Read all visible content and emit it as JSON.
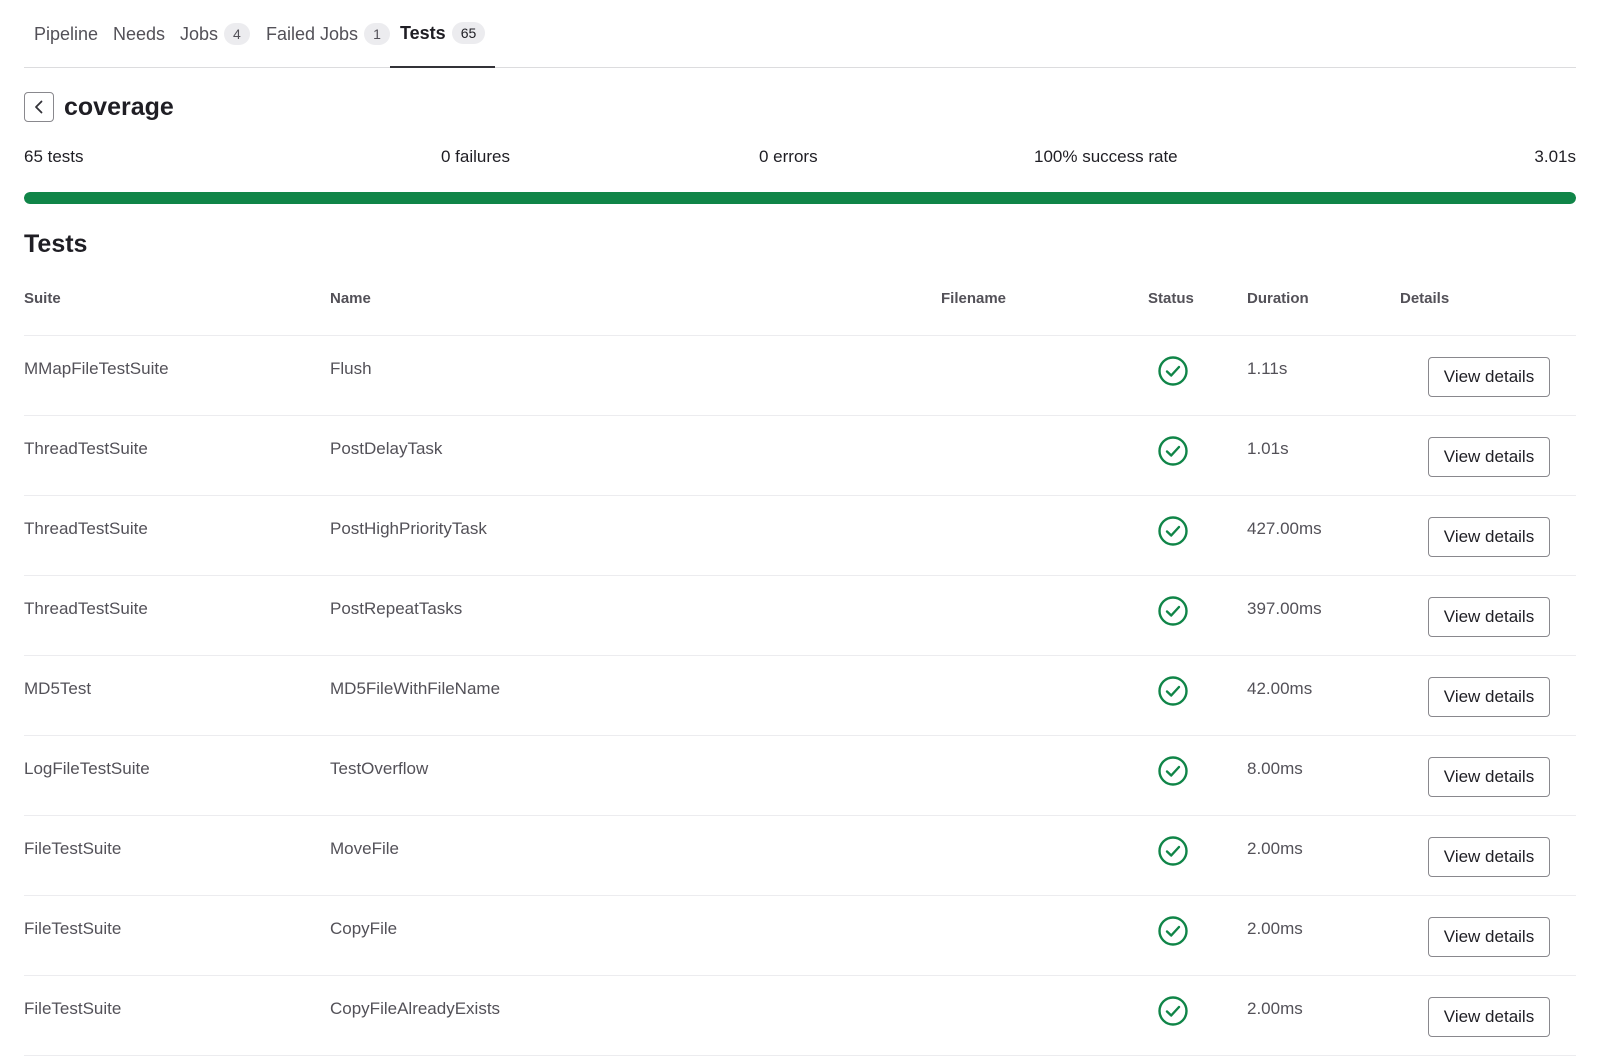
{
  "tabs": [
    {
      "label": "Pipeline",
      "count": null
    },
    {
      "label": "Needs",
      "count": null
    },
    {
      "label": "Jobs",
      "count": "4"
    },
    {
      "label": "Failed Jobs",
      "count": "1"
    },
    {
      "label": "Tests",
      "count": "65"
    }
  ],
  "suite_name": "coverage",
  "summary": {
    "tests": "65 tests",
    "failures": "0 failures",
    "errors": "0 errors",
    "success_rate": "100% success rate",
    "duration": "3.01s",
    "success_fraction": 1.0
  },
  "colors": {
    "success": "#108548",
    "accent": "#333238"
  },
  "section_title": "Tests",
  "table": {
    "columns": [
      "Suite",
      "Name",
      "Filename",
      "Status",
      "Duration",
      "Details"
    ],
    "rows": [
      {
        "suite": "MMapFileTestSuite",
        "name": "Flush",
        "filename": "",
        "status": "success",
        "duration": "1.11s",
        "details": "View details"
      },
      {
        "suite": "ThreadTestSuite",
        "name": "PostDelayTask",
        "filename": "",
        "status": "success",
        "duration": "1.01s",
        "details": "View details"
      },
      {
        "suite": "ThreadTestSuite",
        "name": "PostHighPriorityTask",
        "filename": "",
        "status": "success",
        "duration": "427.00ms",
        "details": "View details"
      },
      {
        "suite": "ThreadTestSuite",
        "name": "PostRepeatTasks",
        "filename": "",
        "status": "success",
        "duration": "397.00ms",
        "details": "View details"
      },
      {
        "suite": "MD5Test",
        "name": "MD5FileWithFileName",
        "filename": "",
        "status": "success",
        "duration": "42.00ms",
        "details": "View details"
      },
      {
        "suite": "LogFileTestSuite",
        "name": "TestOverflow",
        "filename": "",
        "status": "success",
        "duration": "8.00ms",
        "details": "View details"
      },
      {
        "suite": "FileTestSuite",
        "name": "MoveFile",
        "filename": "",
        "status": "success",
        "duration": "2.00ms",
        "details": "View details"
      },
      {
        "suite": "FileTestSuite",
        "name": "CopyFile",
        "filename": "",
        "status": "success",
        "duration": "2.00ms",
        "details": "View details"
      },
      {
        "suite": "FileTestSuite",
        "name": "CopyFileAlreadyExists",
        "filename": "",
        "status": "success",
        "duration": "2.00ms",
        "details": "View details"
      }
    ]
  },
  "icons": {
    "back": "chevron-left-icon",
    "status_success": "check-circle-icon"
  }
}
